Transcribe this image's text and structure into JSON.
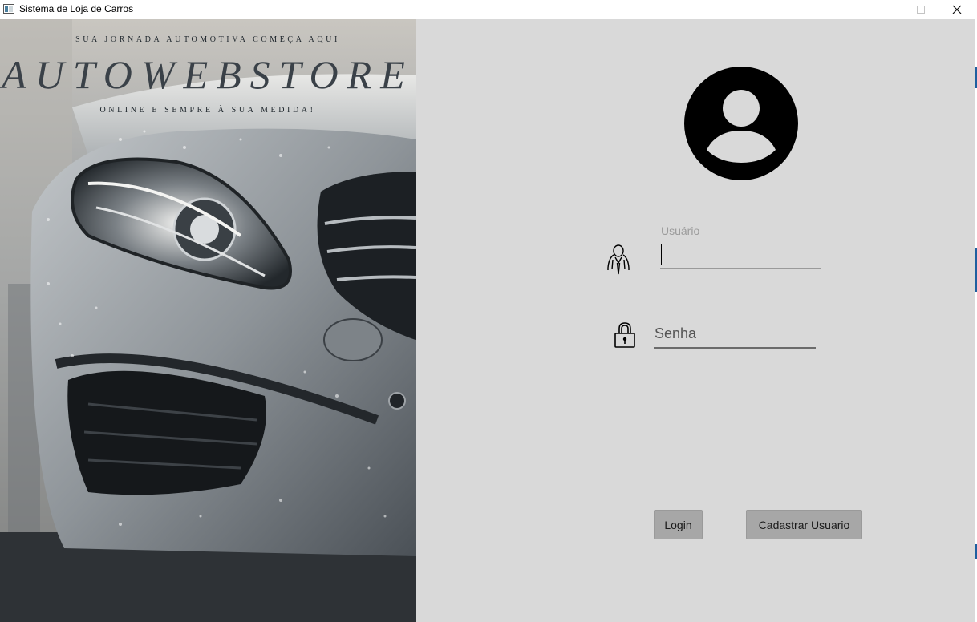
{
  "window": {
    "title": "Sistema de Loja de Carros",
    "controls": [
      "minimize-icon",
      "maximize-icon",
      "close-icon"
    ]
  },
  "hero": {
    "tagline_top": "SUA JORNADA AUTOMOTIVA COMEÇA AQUI",
    "brand": "AUTOWEBSTORE",
    "tagline_bottom": "ONLINE E SEMPRE À SUA MEDIDA!",
    "image": "silver-car-front-photo"
  },
  "login": {
    "avatar_icon": "account-circle-icon",
    "username": {
      "label": "Usuário",
      "value": "",
      "icon": "user-person-icon"
    },
    "password": {
      "placeholder": "Senha",
      "value": "",
      "icon": "padlock-icon"
    },
    "login_button": "Login",
    "register_button": "Cadastrar Usuario"
  },
  "colors": {
    "panel_background": "#d9d9d9",
    "button_background": "#a7a7a7"
  }
}
